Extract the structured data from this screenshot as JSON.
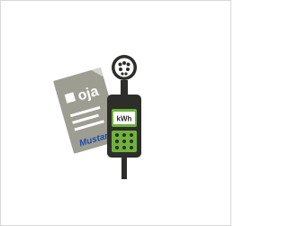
{
  "document": {
    "label": "oja",
    "signature": "Mustan"
  },
  "meter": {
    "display_label": "kWh"
  },
  "colors": {
    "paper": "#9d9d92",
    "signature": "#1f4ea8",
    "device_body": "#2d2e2a",
    "device_screen": "#6fb23c",
    "device_highlight": "#ffffff"
  }
}
